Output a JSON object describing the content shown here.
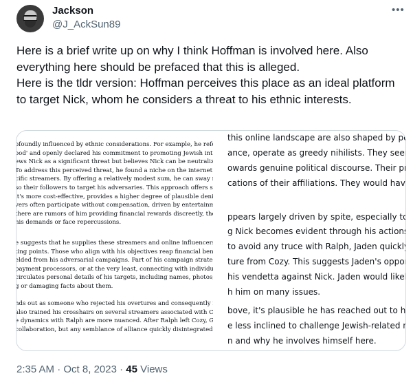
{
  "author": {
    "display_name": "Jackson",
    "handle": "@J_AckSun89"
  },
  "menu_icon": "more-horizontal-icon",
  "tweet": {
    "text": "Here is a brief write up on why I think Hoffman is involved here. Also everything here should be prefaced that this is alleged.\nHere is the tldr version: Hoffman perceives this place as an ideal platform to target Nick, whom he considers a threat to his ethnic interests."
  },
  "image": {
    "left_column_paragraphs": [
      [
        "ofoundly influenced by ethnic considerations. For example, he referre",
        "ood' and openly declared his commitment to promoting Jewish inter",
        "ews Nick as a significant threat but believes Nick can be neutralized v",
        "To address this perceived threat, he found a niche on the internet wh",
        "cific streamers. By offering a relatively modest sum, he can sway not",
        "so their followers to target his adversaries. This approach offers seve",
        "it's more cost-effective, provides a higher degree of plausible denial",
        "vers often participate without compensation, driven by entertainmen",
        "there are rumors of him providing financial rewards discreetly, there",
        "his demands or face repercussions."
      ],
      [
        "e suggests that he supplies these streamers and online influencers w",
        "ting points. Those who align with his objectives reap financial benefi",
        "elded from his adversarial campaigns. Part of his campaign strategy a",
        "payment processors, or at the very least, connecting with individuals",
        "circulates personal details of his targets, including names, photos, to",
        "g or damaging facts about them."
      ],
      [
        "nds out as someone who rejected his overtures and consequently fo",
        "also trained his crosshairs on several streamers associated with Cozy",
        "e dynamics with Ralph are more nuanced. After Ralph left Cozy, Gab",
        "collaboration, but any semblance of alliance quickly disintegrated wh"
      ]
    ],
    "right_column_lines": [
      "this online landscape are also shaped by perso",
      "ance, operate as greedy nihilists. They seem m",
      "owards genuine political discourse. Their prima",
      "cations of their affiliations. They would have no",
      "ppears largely driven by spite, especially toward",
      "g Nick becomes evident through his actions. De",
      "to avoid any truce with Ralph, Jaden quickly att",
      "ture from Cozy. This suggests Jaden's opportun",
      "his vendetta against Nick. Jaden would likely b",
      "h him on many issues.",
      "bove, it's plausible he has reached out to high-p",
      "e less inclined to challenge Jewish-related narra",
      "n and why he involves himself here."
    ]
  },
  "meta": {
    "time": "2:35 AM",
    "separator1": " · ",
    "date": "Oct 8, 2023",
    "separator2": " · ",
    "views_count": "45",
    "views_label": " Views"
  }
}
